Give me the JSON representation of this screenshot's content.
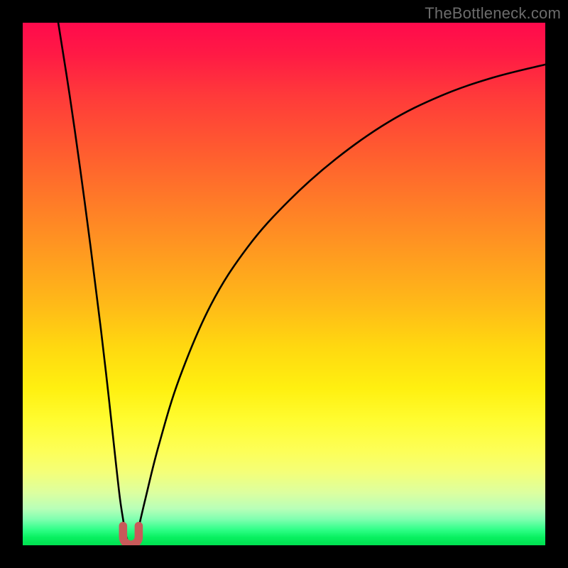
{
  "watermark": "TheBottleneck.com",
  "colors": {
    "frame": "#000000",
    "curve": "#000000",
    "marker_fill": "#c85a5a",
    "marker_stroke": "#c85a5a"
  },
  "chart_data": {
    "type": "line",
    "title": "",
    "xlabel": "",
    "ylabel": "",
    "xlim": [
      0,
      1
    ],
    "ylim": [
      0,
      1
    ],
    "annotations": [],
    "series": [
      {
        "name": "left-branch",
        "x": [
          0.068,
          0.09,
          0.11,
          0.13,
          0.15,
          0.165,
          0.178,
          0.186,
          0.192,
          0.196,
          0.2
        ],
        "y": [
          1.0,
          0.86,
          0.72,
          0.57,
          0.41,
          0.28,
          0.16,
          0.09,
          0.05,
          0.025,
          0.01
        ]
      },
      {
        "name": "right-branch",
        "x": [
          0.215,
          0.222,
          0.235,
          0.26,
          0.3,
          0.36,
          0.43,
          0.51,
          0.6,
          0.7,
          0.8,
          0.9,
          1.0
        ],
        "y": [
          0.01,
          0.035,
          0.09,
          0.19,
          0.32,
          0.46,
          0.57,
          0.66,
          0.74,
          0.81,
          0.86,
          0.895,
          0.92
        ]
      }
    ],
    "marker": {
      "name": "minimum-marker-U",
      "cx": 0.207,
      "cy": 0.016,
      "radius": 0.015
    }
  }
}
